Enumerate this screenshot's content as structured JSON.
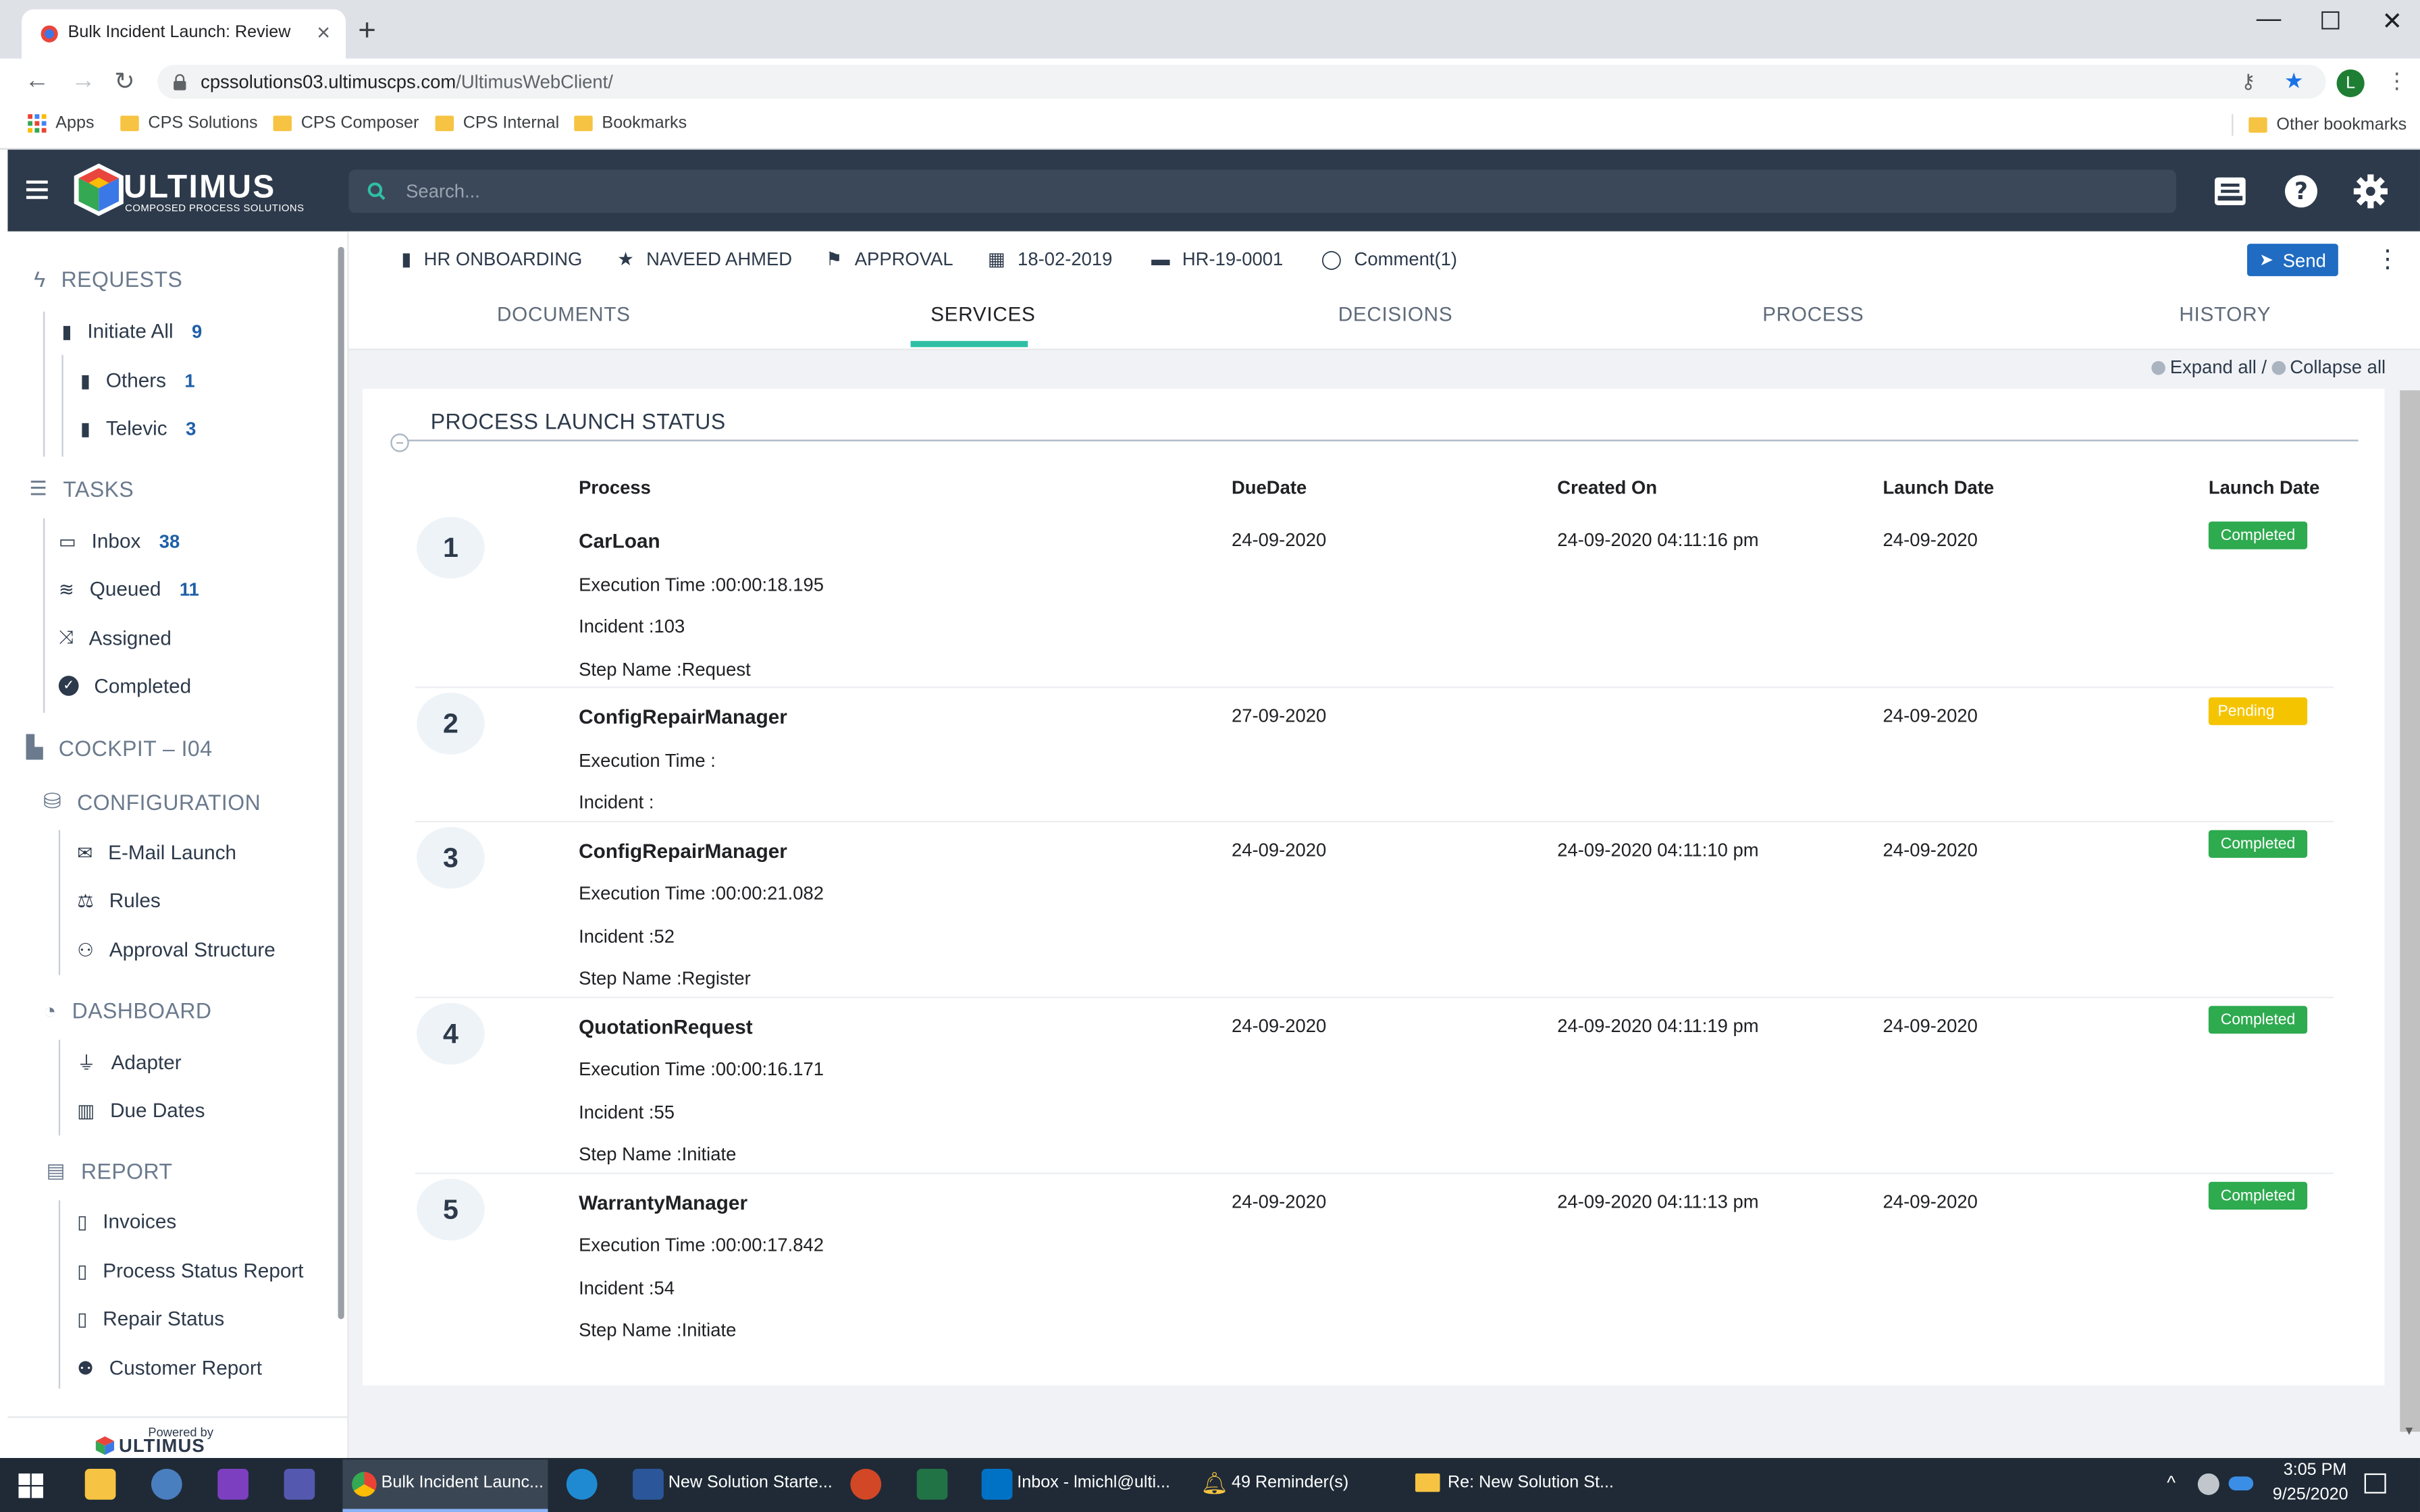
{
  "browser": {
    "tab_title": "Bulk Incident Launch: Review",
    "url_host": "cpssolutions03.ultimuscps.com",
    "url_path": "/UltimusWebClient/",
    "profile_initial": "L",
    "bookmarks": [
      "Apps",
      "CPS Solutions",
      "CPS Composer",
      "CPS Internal",
      "Bookmarks"
    ],
    "other_bookmarks": "Other bookmarks"
  },
  "header": {
    "logo_text": "ULTIMUS",
    "logo_tagline": "COMPOSED PROCESS SOLUTIONS",
    "search_placeholder": "Search..."
  },
  "sidebar": {
    "requests": {
      "label": "REQUESTS",
      "items": [
        {
          "label": "Initiate All",
          "count": "9"
        },
        {
          "label": "Others",
          "count": "1"
        },
        {
          "label": "Televic",
          "count": "3"
        }
      ]
    },
    "tasks": {
      "label": "TASKS",
      "items": [
        {
          "label": "Inbox",
          "count": "38"
        },
        {
          "label": "Queued",
          "count": "11"
        },
        {
          "label": "Assigned"
        },
        {
          "label": "Completed"
        }
      ]
    },
    "cockpit": {
      "label": "COCKPIT – I04"
    },
    "configuration": {
      "label": "CONFIGURATION",
      "items": [
        {
          "label": "E-Mail Launch"
        },
        {
          "label": "Rules"
        },
        {
          "label": "Approval Structure"
        }
      ]
    },
    "dashboard": {
      "label": "DASHBOARD",
      "items": [
        {
          "label": "Adapter"
        },
        {
          "label": "Due Dates"
        }
      ]
    },
    "report": {
      "label": "REPORT",
      "items": [
        {
          "label": "Invoices"
        },
        {
          "label": "Process Status Report"
        },
        {
          "label": "Repair Status"
        },
        {
          "label": "Customer Report"
        }
      ]
    },
    "powered_by": "Powered by",
    "footer_logo": "ULTIMUS"
  },
  "infobar": {
    "process": "HR ONBOARDING",
    "user": "NAVEED AHMED",
    "step": "APPROVAL",
    "date": "18-02-2019",
    "incident": "HR-19-0001",
    "comment": "Comment(1)",
    "send_label": "Send"
  },
  "tabs": [
    {
      "label": "DOCUMENTS"
    },
    {
      "label": "SERVICES",
      "active": true
    },
    {
      "label": "DECISIONS"
    },
    {
      "label": "PROCESS"
    },
    {
      "label": "HISTORY"
    }
  ],
  "controls": {
    "expand_all": "Expand all /",
    "collapse_all": "Collapse all"
  },
  "panel": {
    "title": "PROCESS LAUNCH STATUS",
    "columns": [
      "Process",
      "DueDate",
      "Created On",
      "Launch Date",
      "Launch Date"
    ],
    "rows": [
      {
        "num": "1",
        "name": "CarLoan",
        "details": [
          "Execution Time :00:00:18.195",
          "Incident :103",
          "Step Name :Request"
        ],
        "due": "24-09-2020",
        "created": "24-09-2020 04:11:16 pm",
        "launch": "24-09-2020",
        "status": "Completed"
      },
      {
        "num": "2",
        "name": "ConfigRepairManager",
        "details": [
          "Execution Time :",
          "Incident :"
        ],
        "due": "27-09-2020",
        "created": "",
        "launch": "24-09-2020",
        "status": "Pending"
      },
      {
        "num": "3",
        "name": "ConfigRepairManager",
        "details": [
          "Execution Time :00:00:21.082",
          "Incident :52",
          "Step Name :Register"
        ],
        "due": "24-09-2020",
        "created": "24-09-2020 04:11:10 pm",
        "launch": "24-09-2020",
        "status": "Completed"
      },
      {
        "num": "4",
        "name": "QuotationRequest",
        "details": [
          "Execution Time :00:00:16.171",
          "Incident :55",
          "Step Name :Initiate"
        ],
        "due": "24-09-2020",
        "created": "24-09-2020 04:11:19 pm",
        "launch": "24-09-2020",
        "status": "Completed"
      },
      {
        "num": "5",
        "name": "WarrantyManager",
        "details": [
          "Execution Time :00:00:17.842",
          "Incident :54",
          "Step Name :Initiate"
        ],
        "due": "24-09-2020",
        "created": "24-09-2020 04:11:13 pm",
        "launch": "24-09-2020",
        "status": "Completed"
      }
    ]
  },
  "status_colors": {
    "Completed": "#2eaa4f",
    "Pending": "#f5c400"
  },
  "taskbar": {
    "items": [
      "Bulk Incident Launc...",
      "New Solution Starte...",
      "Inbox - lmichl@ulti...",
      "49 Reminder(s)",
      "Re: New Solution St..."
    ],
    "time": "3:05 PM",
    "date": "9/25/2020"
  }
}
